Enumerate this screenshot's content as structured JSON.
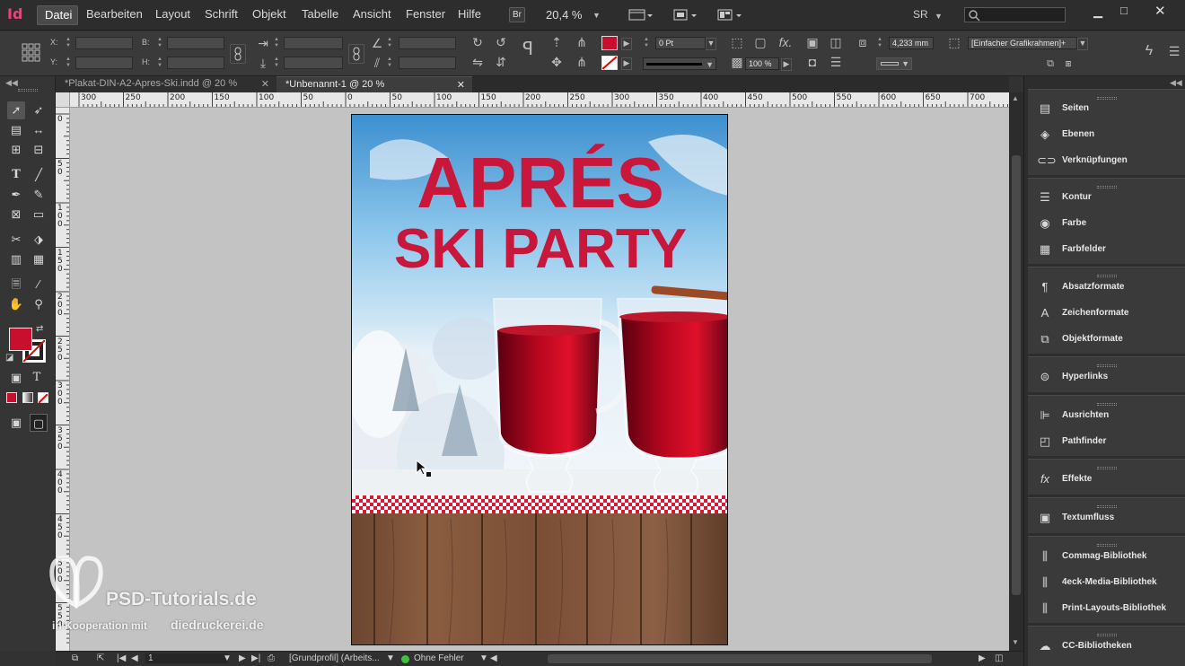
{
  "app": {
    "logo": "Id"
  },
  "menu": {
    "items": [
      "Datei",
      "Bearbeiten",
      "Layout",
      "Schrift",
      "Objekt",
      "Tabelle",
      "Ansicht",
      "Fenster",
      "Hilfe"
    ],
    "bridge_label": "Br",
    "zoom": "20,4 %",
    "workspace": "SR"
  },
  "control": {
    "x_label": "X:",
    "y_label": "Y:",
    "w_label": "B:",
    "h_label": "H:",
    "stroke_weight": "0 Pt",
    "opacity": "100 %",
    "frame_width": "4,233 mm",
    "object_style": "[Einfacher Grafikrahmen]+",
    "fill_color": "#c8102e"
  },
  "tabs": [
    {
      "label": "*Plakat-DIN-A2-Apres-Ski.indd @ 20 %",
      "active": false
    },
    {
      "label": "*Unbenannt-1 @ 20 %",
      "active": true
    }
  ],
  "ruler": {
    "h_ticks": [
      "300",
      "250",
      "200",
      "150",
      "100",
      "50",
      "0",
      "50",
      "100",
      "150",
      "200",
      "250",
      "300",
      "350",
      "400",
      "450",
      "500",
      "550",
      "600",
      "650",
      "700"
    ],
    "v_ticks": [
      "0",
      "50",
      "100",
      "150",
      "200",
      "250",
      "300",
      "350",
      "400",
      "450",
      "500",
      "550"
    ]
  },
  "poster": {
    "headline_1": "APRÉS",
    "headline_2": "SKI PARTY",
    "accent_color": "#c8173a"
  },
  "status": {
    "page_number": "1",
    "profile": "[Grundprofil] (Arbeits...",
    "preflight": "Ohne Fehler",
    "preflight_color": "#3ec23e"
  },
  "panels": {
    "group1": [
      "Seiten",
      "Ebenen",
      "Verknüpfungen"
    ],
    "group2": [
      "Kontur",
      "Farbe",
      "Farbfelder"
    ],
    "group3": [
      "Absatzformate",
      "Zeichenformate",
      "Objektformate"
    ],
    "group4": [
      "Hyperlinks"
    ],
    "group5": [
      "Ausrichten",
      "Pathfinder"
    ],
    "group6": [
      "Effekte"
    ],
    "group7": [
      "Textumfluss"
    ],
    "group8": [
      "Commag-Bibliothek",
      "4eck-Media-Bibliothek",
      "Print-Layouts-Bibliothek"
    ],
    "group9": [
      "CC-Bibliotheken"
    ]
  },
  "watermark": {
    "brand": "PSD-Tutorials.de",
    "coop": "in Kooperation mit",
    "partner": "diedruckerei.de"
  }
}
